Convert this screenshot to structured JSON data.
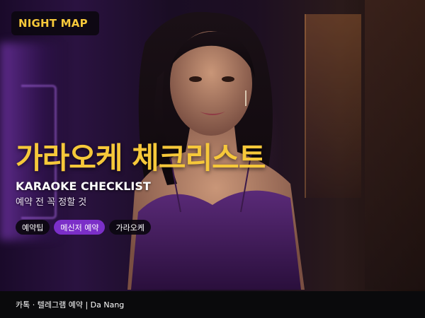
{
  "badge": {
    "label": "NIGHT MAP"
  },
  "headline": {
    "title": "가라오케 체크리스트",
    "subtitle_en": "KARAOKE CHECKLIST",
    "subtitle_ko": "예약 전 꼭 정할 것"
  },
  "tags": [
    {
      "label": "예약팁",
      "active": false
    },
    {
      "label": "메신저 예약",
      "active": true
    },
    {
      "label": "가라오케",
      "active": false
    }
  ],
  "footer": {
    "text": "카톡 · 텔레그램 예약 | Da Nang"
  },
  "colors": {
    "accent_yellow": "#f6c83a",
    "active_tag": "#7b2fc8",
    "dark_pill": "#0c0810",
    "footer_bg": "#0a0a0c"
  }
}
